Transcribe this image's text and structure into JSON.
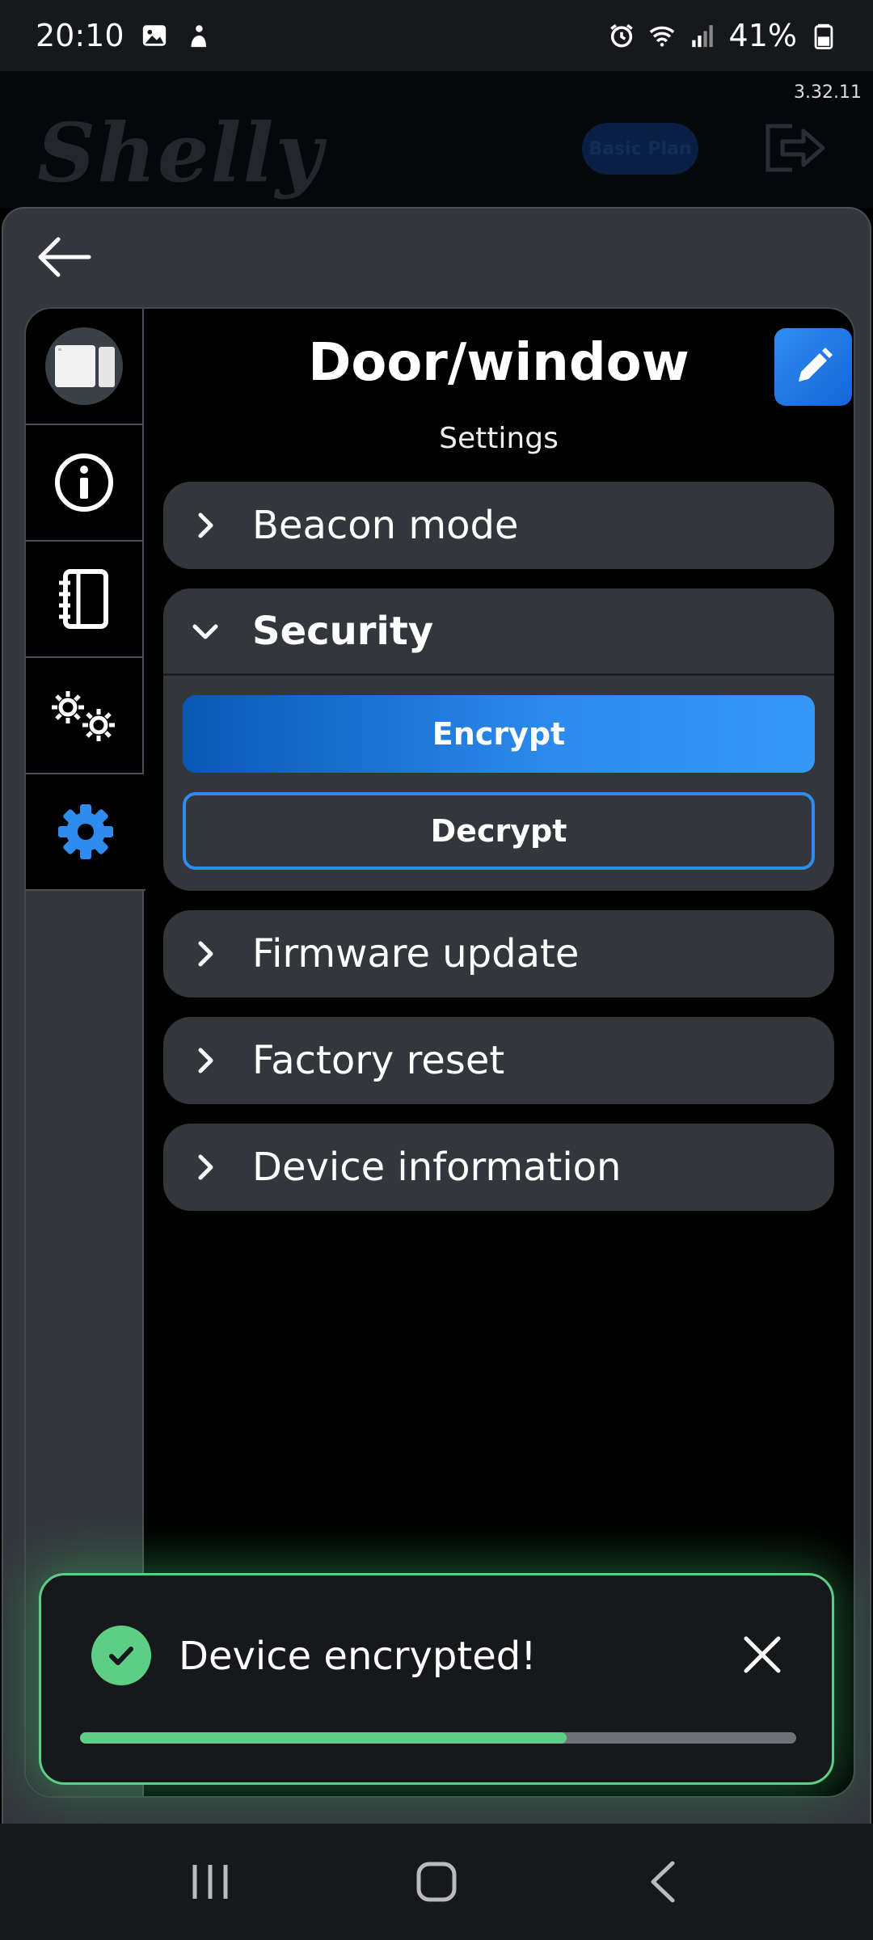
{
  "status_bar": {
    "time": "20:10",
    "battery": "41%"
  },
  "app_header": {
    "logo": "Shelly",
    "version": "3.32.11",
    "plan_badge": "Basic Plan"
  },
  "device": {
    "title": "Door/window",
    "subtitle": "Settings"
  },
  "sidebar": {
    "tabs": [
      {
        "name": "device",
        "icon": "device-image"
      },
      {
        "name": "info",
        "icon": "info-icon"
      },
      {
        "name": "log",
        "icon": "notebook-icon"
      },
      {
        "name": "actions",
        "icon": "gears-icon"
      },
      {
        "name": "settings",
        "icon": "gear-icon",
        "active": true
      }
    ]
  },
  "settings_sections": {
    "beacon": "Beacon mode",
    "security": "Security",
    "encrypt": "Encrypt",
    "decrypt": "Decrypt",
    "firmware": "Firmware update",
    "factory_reset": "Factory reset",
    "device_info": "Device information"
  },
  "toast": {
    "message": "Device encrypted!",
    "progress": 0.68
  },
  "colors": {
    "accent": "#2d8cee",
    "success": "#5ccf85",
    "panel": "#33373c"
  }
}
